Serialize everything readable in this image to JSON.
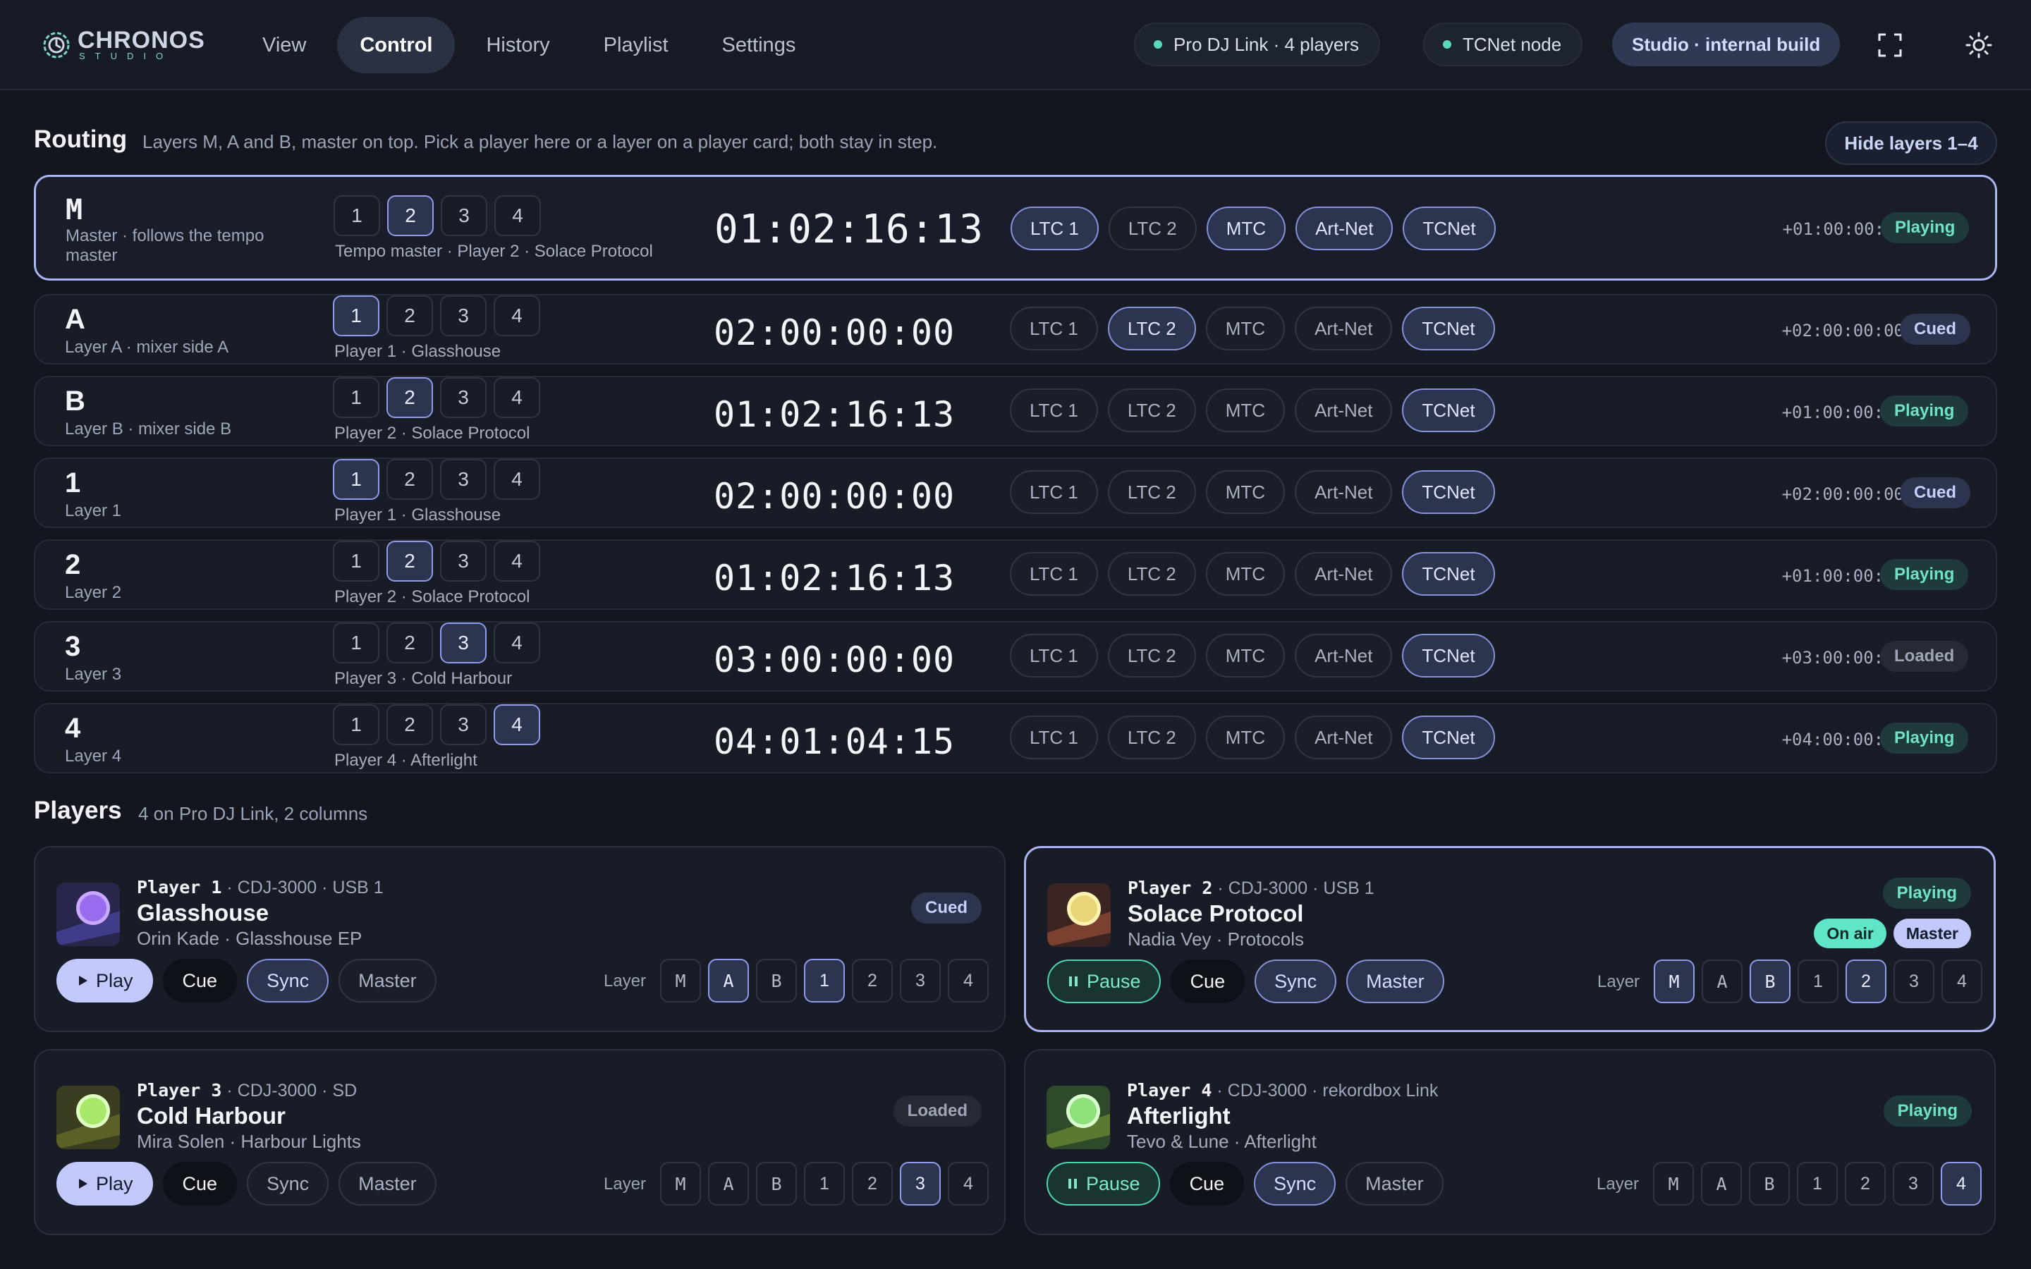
{
  "app": {
    "name": "CHRONOS",
    "sub": "STUDIO"
  },
  "nav": [
    {
      "label": "View",
      "active": false
    },
    {
      "label": "Control",
      "active": true
    },
    {
      "label": "History",
      "active": false
    },
    {
      "label": "Playlist",
      "active": false
    },
    {
      "label": "Settings",
      "active": false
    }
  ],
  "status": {
    "prodj": "Pro DJ Link ·  4  players",
    "tcnet": "TCNet node",
    "build": "Studio · internal build"
  },
  "icons": {
    "fullscreen": "fullscreen-icon",
    "theme": "sun-icon",
    "play": "play-icon",
    "pause": "pause-icon"
  },
  "colors": {
    "accent": "#aab4f0",
    "playing": "#6fe3c4",
    "background": "#13161f"
  },
  "routing": {
    "title": "Routing",
    "subtitle": "Layers M, A and B, master on top. Pick a player here or a layer on a player card; both stay in step.",
    "hide_label": "Hide layers 1–4",
    "outputs": [
      "LTC 1",
      "LTC 2",
      "MTC",
      "Art-Net",
      "TCNet"
    ],
    "player_nums": [
      "1",
      "2",
      "3",
      "4"
    ],
    "rows": [
      {
        "id": "M",
        "desc": "Master · follows the tempo master",
        "player": "Tempo master · Player 2 · Solace Protocol",
        "sel": 2,
        "tc": "01:02:16:13",
        "outputs_on": [
          true,
          false,
          true,
          true,
          true
        ],
        "offset": "+01:00:00:00",
        "status": "Playing"
      },
      {
        "id": "A",
        "desc": "Layer A · mixer side A",
        "player": "Player 1 · Glasshouse",
        "sel": 1,
        "tc": "02:00:00:00",
        "outputs_on": [
          false,
          true,
          false,
          false,
          true
        ],
        "offset": "+02:00:00:00",
        "status": "Cued"
      },
      {
        "id": "B",
        "desc": "Layer B · mixer side B",
        "player": "Player 2 · Solace Protocol",
        "sel": 2,
        "tc": "01:02:16:13",
        "outputs_on": [
          false,
          false,
          false,
          false,
          true
        ],
        "offset": "+01:00:00:00",
        "status": "Playing"
      },
      {
        "id": "1",
        "desc": "Layer 1",
        "player": "Player 1 · Glasshouse",
        "sel": 1,
        "tc": "02:00:00:00",
        "outputs_on": [
          false,
          false,
          false,
          false,
          true
        ],
        "offset": "+02:00:00:00",
        "status": "Cued"
      },
      {
        "id": "2",
        "desc": "Layer 2",
        "player": "Player 2 · Solace Protocol",
        "sel": 2,
        "tc": "01:02:16:13",
        "outputs_on": [
          false,
          false,
          false,
          false,
          true
        ],
        "offset": "+01:00:00:00",
        "status": "Playing"
      },
      {
        "id": "3",
        "desc": "Layer 3",
        "player": "Player 3 · Cold Harbour",
        "sel": 3,
        "tc": "03:00:00:00",
        "outputs_on": [
          false,
          false,
          false,
          false,
          true
        ],
        "offset": "+03:00:00:00",
        "status": "Loaded"
      },
      {
        "id": "4",
        "desc": "Layer 4",
        "player": "Player 4 · Afterlight",
        "sel": 4,
        "tc": "04:01:04:15",
        "outputs_on": [
          false,
          false,
          false,
          false,
          true
        ],
        "offset": "+04:00:00:00",
        "status": "Playing"
      }
    ]
  },
  "players": {
    "title": "Players",
    "subtitle": "4 on Pro DJ Link, 2 columns",
    "layer_label": "Layer",
    "layers": [
      "M",
      "A",
      "B",
      "1",
      "2",
      "3",
      "4"
    ],
    "buttons": {
      "play": "Play",
      "pause": "Pause",
      "cue": "Cue",
      "sync": "Sync",
      "master": "Master"
    },
    "cards": [
      {
        "player": "Player 1",
        "meta": " · CDJ-3000 · USB 1",
        "title": "Glasshouse",
        "artist": "Orin Kade · Glasshouse EP",
        "status": "Cued",
        "state": "cued",
        "transport": "play",
        "sync_on": true,
        "master_on": false,
        "layers_on": [
          "A",
          "1"
        ],
        "on_air": "",
        "master_badge": ""
      },
      {
        "player": "Player 2",
        "meta": " · CDJ-3000 · USB 1",
        "title": "Solace Protocol",
        "artist": "Nadia Vey · Protocols",
        "status": "Playing",
        "state": "playing",
        "transport": "pause",
        "sync_on": true,
        "master_on": true,
        "layers_on": [
          "M",
          "B",
          "2"
        ],
        "on_air": "On air",
        "master_badge": "Master"
      },
      {
        "player": "Player 3",
        "meta": " · CDJ-3000 · SD",
        "title": "Cold Harbour",
        "artist": "Mira Solen · Harbour Lights",
        "status": "Loaded",
        "state": "loaded",
        "transport": "play",
        "sync_on": false,
        "master_on": false,
        "layers_on": [
          "3"
        ],
        "on_air": "",
        "master_badge": ""
      },
      {
        "player": "Player 4",
        "meta": " · CDJ-3000 · rekordbox Link",
        "title": "Afterlight",
        "artist": "Tevo & Lune · Afterlight",
        "status": "Playing",
        "state": "playing",
        "transport": "pause",
        "sync_on": true,
        "master_on": false,
        "layers_on": [
          "4"
        ],
        "on_air": "",
        "master_badge": ""
      }
    ]
  }
}
